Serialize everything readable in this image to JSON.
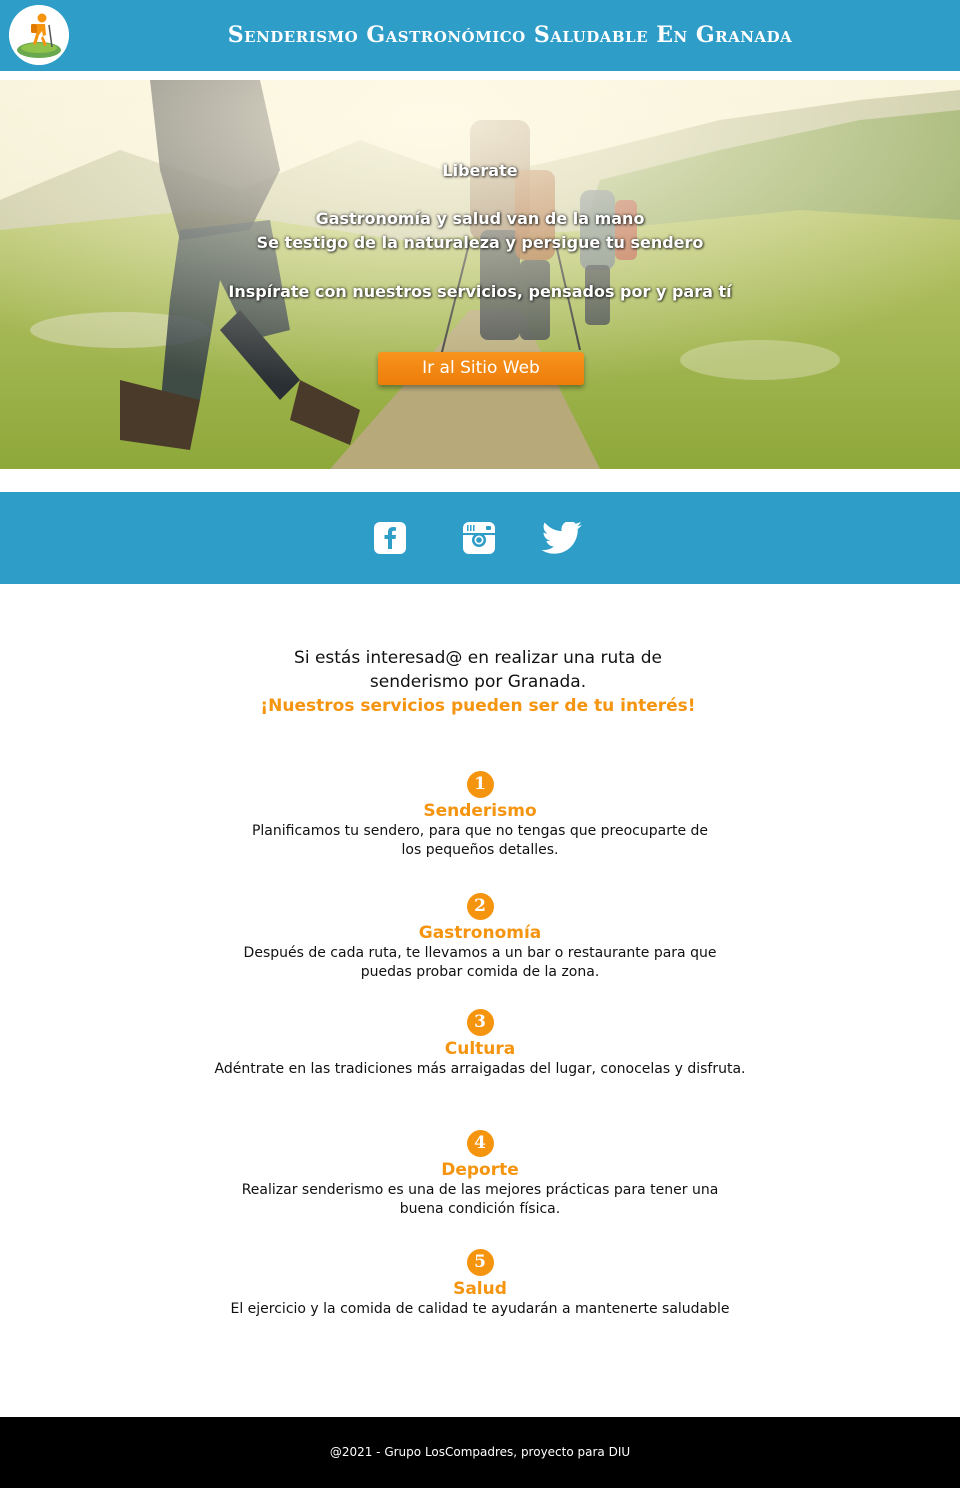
{
  "header": {
    "title": "Senderismo Gastronómico Saludable En Granada"
  },
  "hero": {
    "line1": "Liberate",
    "line2": "Gastronomía y salud van de la mano",
    "line3": "Se testigo de la naturaleza y persigue tu sendero",
    "line4": "Inspírate con nuestros servicios, pensados por y para tí",
    "cta_label": "Ir al Sitio Web"
  },
  "social": {
    "items": [
      "facebook-icon",
      "instagram-icon",
      "twitter-icon"
    ]
  },
  "intro": {
    "line1": "Si estás interesad@ en realizar una ruta de",
    "line2": "senderismo por Granada.",
    "highlight": "¡Nuestros servicios pueden ser de tu interés!"
  },
  "services": [
    {
      "number": "1",
      "title": "Senderismo",
      "desc": "Planificamos tu sendero, para que no tengas que preocuparte de los pequeños detalles."
    },
    {
      "number": "2",
      "title": "Gastronomía",
      "desc": "Después de cada ruta, te llevamos a un bar o restaurante para que puedas probar comida de la zona."
    },
    {
      "number": "3",
      "title": "Cultura",
      "desc": "Adéntrate en las tradiciones más arraigadas del lugar, conocelas y disfruta."
    },
    {
      "number": "4",
      "title": "Deporte",
      "desc": "Realizar senderismo es una de las mejores prácticas para tener una buena condición física."
    },
    {
      "number": "5",
      "title": "Salud",
      "desc": "El ejercicio y la comida de calidad te ayudarán a mantenerte saludable"
    }
  ],
  "footer": {
    "text": "@2021 - Grupo LosCompadres, proyecto para DIU"
  },
  "colors": {
    "primary": "#2e9dc8",
    "accent": "#f5940e",
    "footer": "#000000"
  }
}
